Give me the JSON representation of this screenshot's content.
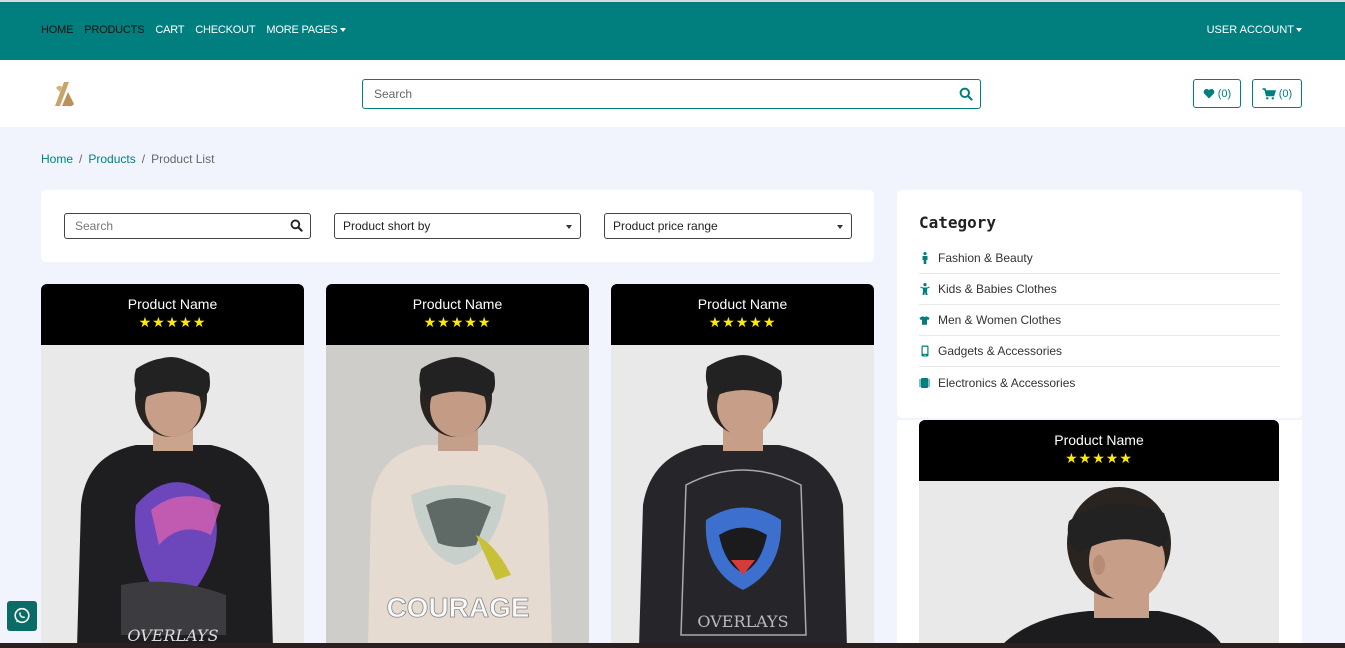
{
  "topnav": {
    "items": [
      {
        "label": "HOME"
      },
      {
        "label": "PRODUCTS"
      },
      {
        "label": "CART"
      },
      {
        "label": "CHECKOUT"
      },
      {
        "label": "MORE PAGES"
      }
    ],
    "user_account": "USER ACCOUNT"
  },
  "header": {
    "search_placeholder": "Search",
    "wishlist_count": "(0)",
    "cart_count": "(0)"
  },
  "breadcrumb": {
    "home": "Home",
    "products": "Products",
    "current": "Product List",
    "separator": "/"
  },
  "filters": {
    "search_placeholder": "Search",
    "sort_label": "Product short by",
    "price_label": "Product price range"
  },
  "products": [
    {
      "name": "Product Name",
      "stars": "★★★★★",
      "rating": 5,
      "print_text": "OVERLAYS"
    },
    {
      "name": "Product Name",
      "stars": "★★★★★",
      "rating": 5,
      "print_text": "COURAGE"
    },
    {
      "name": "Product Name",
      "stars": "★★★★★",
      "rating": 5,
      "print_text": "OVERLAYS"
    }
  ],
  "side_product": {
    "name": "Product Name",
    "stars": "★★★★★",
    "rating": 5
  },
  "category": {
    "title": "Category",
    "items": [
      {
        "label": "Fashion & Beauty",
        "icon": "person-icon"
      },
      {
        "label": "Kids & Babies Clothes",
        "icon": "child-icon"
      },
      {
        "label": "Men & Women Clothes",
        "icon": "tshirt-icon"
      },
      {
        "label": "Gadgets & Accessories",
        "icon": "mobile-icon"
      },
      {
        "label": "Electronics & Accessories",
        "icon": "chip-icon"
      }
    ]
  },
  "colors": {
    "brand": "#017f7f",
    "stars": "#ffeb00",
    "page_bg": "#f1f4fd"
  }
}
